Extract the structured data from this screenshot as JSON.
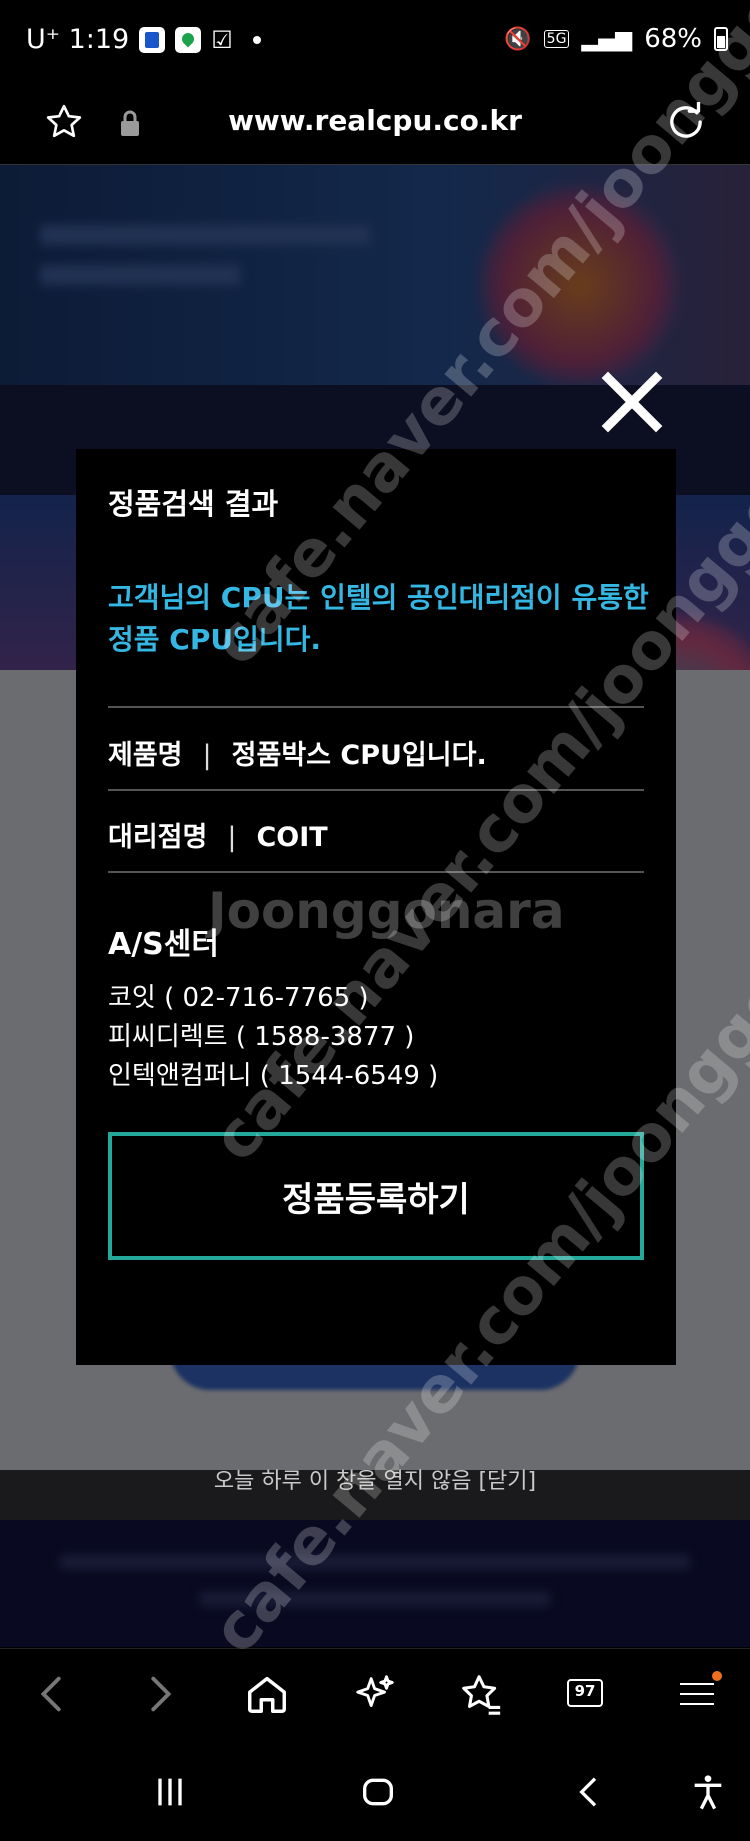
{
  "status_bar": {
    "carrier": "U⁺ 1:19",
    "network": "5G",
    "battery": "68%"
  },
  "browser": {
    "url": "www.realcpu.co.kr"
  },
  "modal": {
    "title": "정품검색 결과",
    "description": "고객님의 CPU는 인텔의 공인대리점이 유통한 정품 CPU입니다.",
    "product_label": "제품명",
    "separator": "|",
    "product_value": "정품박스 CPU입니다.",
    "dealer_label": "대리점명",
    "dealer_value": "COIT",
    "as_title": "A/S센터",
    "as_centers": [
      "코잇 ( 02-716-7765 )",
      "피씨디렉트 ( 1588-3877 )",
      "인텍앤컴퍼니 ( 1544-6549 )"
    ],
    "register_button": "정품등록하기"
  },
  "background_page": {
    "no_today_text": "오늘 하루 이 창을 열지 않음 [닫기]"
  },
  "bottom_nav": {
    "tab_count": "97"
  },
  "watermark": {
    "text": "cafe.naver.com/joonggonara",
    "brand": "Joonggonara"
  },
  "colors": {
    "accent_blue": "#35b7e3",
    "button_border": "#23a89a"
  }
}
